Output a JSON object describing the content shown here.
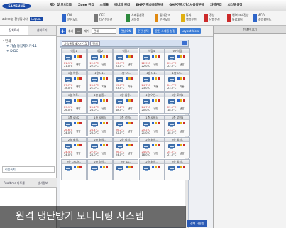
{
  "header": {
    "logo": "SAMSUNG",
    "menu": [
      "제어 및 모니터링",
      "Zone 관리",
      "스케줄",
      "에너지 관리",
      "EHP전력사용량분배",
      "GHP전력/가스사용량분배",
      "차량관리",
      "시스템설정"
    ]
  },
  "welcome": {
    "text": "admin님 환영합니다.",
    "badge": "Logout"
  },
  "legend": {
    "groups": [
      {
        "items": [
          {
            "label": "ON",
            "color": "#2d64c8"
          },
          {
            "label": "운전모드",
            "color": "#2d64c8"
          }
        ]
      },
      {
        "items": [
          {
            "label": "OFF",
            "color": "#777777"
          },
          {
            "label": "대건운운전",
            "color": "#777777"
          }
        ]
      },
      {
        "items": [
          {
            "label": "스케줄설정",
            "color": "#2d8a3e"
          },
          {
            "label": "시운정",
            "color": "#2d8a3e"
          }
        ]
      },
      {
        "items": [
          {
            "label": "필터경고",
            "color": "#e08a12"
          },
          {
            "label": "운전모드",
            "color": "#e08a12"
          }
        ]
      },
      {
        "items": [
          {
            "label": "통과",
            "color": "#e0b012"
          },
          {
            "label": "냉방운전",
            "color": "#e0b012"
          }
        ]
      },
      {
        "items": [
          {
            "label": "정상",
            "color": "#cc2a2a"
          },
          {
            "label": "난방운전",
            "color": "#cc2a2a"
          }
        ]
      },
      {
        "items": [
          {
            "label": "냉/피크비정상",
            "color": "#cc2a2a"
          },
          {
            "label": "통합제어",
            "color": "#cc2a2a"
          }
        ]
      },
      {
        "items": [
          {
            "label": "ACO",
            "color": "#2d64c8"
          },
          {
            "label": "중앙평면도",
            "color": "#2d64c8"
          }
        ]
      }
    ]
  },
  "sidebar": {
    "tabs": [
      "장치트리",
      "설비트리"
    ],
    "tree": [
      "- 전체",
      "+ 가습 통합제어기-11",
      "+ DIDO"
    ],
    "group_select": "리움독기",
    "bottom_tabs": [
      "Realtime 다트롤",
      "설비정보"
    ]
  },
  "toolbar": {
    "add": "+",
    "remove": "−",
    "text1": "추가",
    "text2": "제거",
    "select": "전체",
    "buttons": [
      "전실 ON",
      "운전 선택",
      "운전 스케줄 설정",
      "Layout View"
    ]
  },
  "filter": {
    "select1": "가습통합제어기-11",
    "select2": "전체"
  },
  "units": [
    {
      "name": "식당1",
      "t1": "21.9°C",
      "t2": "21.0°C",
      "mode": "냉방"
    },
    {
      "name": "식당2",
      "t1": "22.9°C",
      "t2": "22.0°C",
      "mode": "냉방"
    },
    {
      "name": "식당3",
      "t1": "23.9°C",
      "t2": "22.0°C",
      "mode": "냉방"
    },
    {
      "name": "식당4",
      "t1": "22.9°C",
      "t2": "22.0°C",
      "mode": "냉방"
    },
    {
      "name": "VIP식당",
      "t1": "23.9°C",
      "t2": "22.0°C",
      "mode": "냉방"
    },
    {
      "name": "1층 여행..",
      "t1": "27.7°C",
      "t2": "18.0°C",
      "mode": "냉방"
    },
    {
      "name": "1층 O1..",
      "t1": "25.5°C",
      "t2": "21.0°C",
      "mode": "자동"
    },
    {
      "name": "1층 O1..",
      "t1": "25.1°C",
      "t2": "23.0°C",
      "mode": "자동"
    },
    {
      "name": "1층 O1..",
      "t1": "24.7°C",
      "t2": "23.0°C",
      "mode": "자동"
    },
    {
      "name": "1층 O1..",
      "t1": "24.7°C",
      "t2": "23.0°C",
      "mode": "자동"
    },
    {
      "name": "1층 복도..",
      "t1": "29.9°C",
      "t2": "26.0°C",
      "mode": "냉방"
    },
    {
      "name": "1층 남동..",
      "t1": "25.4°C",
      "t2": "24.0°C",
      "mode": "냉방"
    },
    {
      "name": "1층 남동..",
      "t1": "27.2°C",
      "t2": "18.0°C",
      "mode": "냉방"
    },
    {
      "name": "1층 여인..",
      "t1": "24.7°C",
      "t2": "20.0°C",
      "mode": "냉방"
    },
    {
      "name": "1층 로비1",
      "t1": "25.5°C",
      "t2": "18.0°C",
      "mode": "냉방"
    },
    {
      "name": "1층 로비2",
      "t1": "26.6°C",
      "t2": "24.0°C",
      "mode": "냉방"
    },
    {
      "name": "1층 로비3",
      "t1": "24.4°C",
      "t2": "26.0°C",
      "mode": "냉방"
    },
    {
      "name": "1층 로비4",
      "t1": "26.2°C",
      "t2": "22.0°C",
      "mode": "냉방"
    },
    {
      "name": "1층 로비5",
      "t1": "25.2°C",
      "t2": "21.0°C",
      "mode": "냉방"
    },
    {
      "name": "1층 로비6",
      "t1": "23.1°C",
      "t2": "18.0°C",
      "mode": "냉방"
    },
    {
      "name": "2층 회의..",
      "t1": "24.4°C",
      "t2": "24.0°C",
      "mode": "냉방"
    },
    {
      "name": "2층 회의..",
      "t1": "27.9°C",
      "t2": "24.0°C",
      "mode": "냉방"
    },
    {
      "name": "2층 회의..",
      "t1": "26.1°C",
      "t2": "24.0°C",
      "mode": "냉방"
    },
    {
      "name": "2층 회의..",
      "t1": "24.0°C",
      "t2": "18.0°C",
      "mode": "냉방"
    },
    {
      "name": "2층 회의..",
      "t1": "24.5°C",
      "t2": "21.0°C",
      "mode": "냉방"
    },
    {
      "name": "2층 CFC실..",
      "t1": "",
      "t2": "",
      "mode": ""
    },
    {
      "name": "2층 영이..",
      "t1": "",
      "t2": "",
      "mode": ""
    },
    {
      "name": "2층 1A..",
      "t1": "",
      "t2": "",
      "mode": ""
    },
    {
      "name": "2층 회의..",
      "t1": "",
      "t2": "",
      "mode": ""
    },
    {
      "name": "2층 회의..",
      "t1": "",
      "t2": "",
      "mode": ""
    }
  ],
  "right_panel": {
    "title": "선택된 기기"
  },
  "caption": "원격 냉난방기 모니터링 시스템",
  "bottom_button": "전체 사용중"
}
